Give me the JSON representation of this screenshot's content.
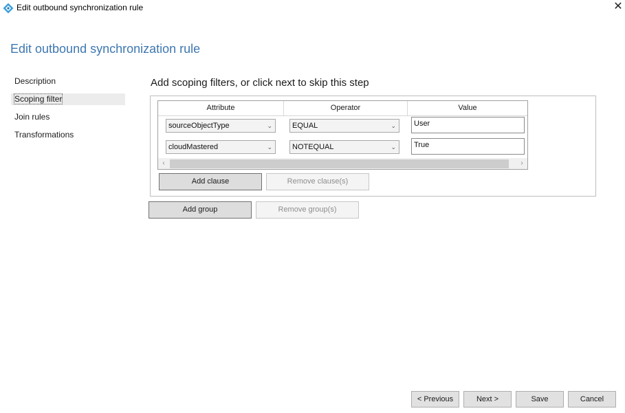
{
  "window": {
    "title": "Edit outbound synchronization rule",
    "close_glyph": "✕",
    "icon": "diamond-app-icon",
    "accent_color": "#3e77b0"
  },
  "page": {
    "title": "Edit outbound synchronization rule"
  },
  "nav": {
    "items": [
      {
        "label": "Description"
      },
      {
        "label": "Scoping filter"
      },
      {
        "label": "Join rules"
      },
      {
        "label": "Transformations"
      }
    ],
    "active_index": 1
  },
  "step": {
    "heading": "Add scoping filters, or click next to skip this step"
  },
  "grid": {
    "columns": [
      "Attribute",
      "Operator",
      "Value"
    ],
    "rows": [
      {
        "attribute": "sourceObjectType",
        "operator": "EQUAL",
        "value": "User"
      },
      {
        "attribute": "cloudMastered",
        "operator": "NOTEQUAL",
        "value": "True"
      }
    ],
    "scroll_left": "‹",
    "scroll_right": "›",
    "chevron": "⌄"
  },
  "clause_buttons": {
    "add": "Add clause",
    "remove": "Remove clause(s)"
  },
  "group_buttons": {
    "add": "Add group",
    "remove": "Remove group(s)"
  },
  "footer": {
    "previous": "< Previous",
    "next": "Next >",
    "save": "Save",
    "cancel": "Cancel"
  }
}
